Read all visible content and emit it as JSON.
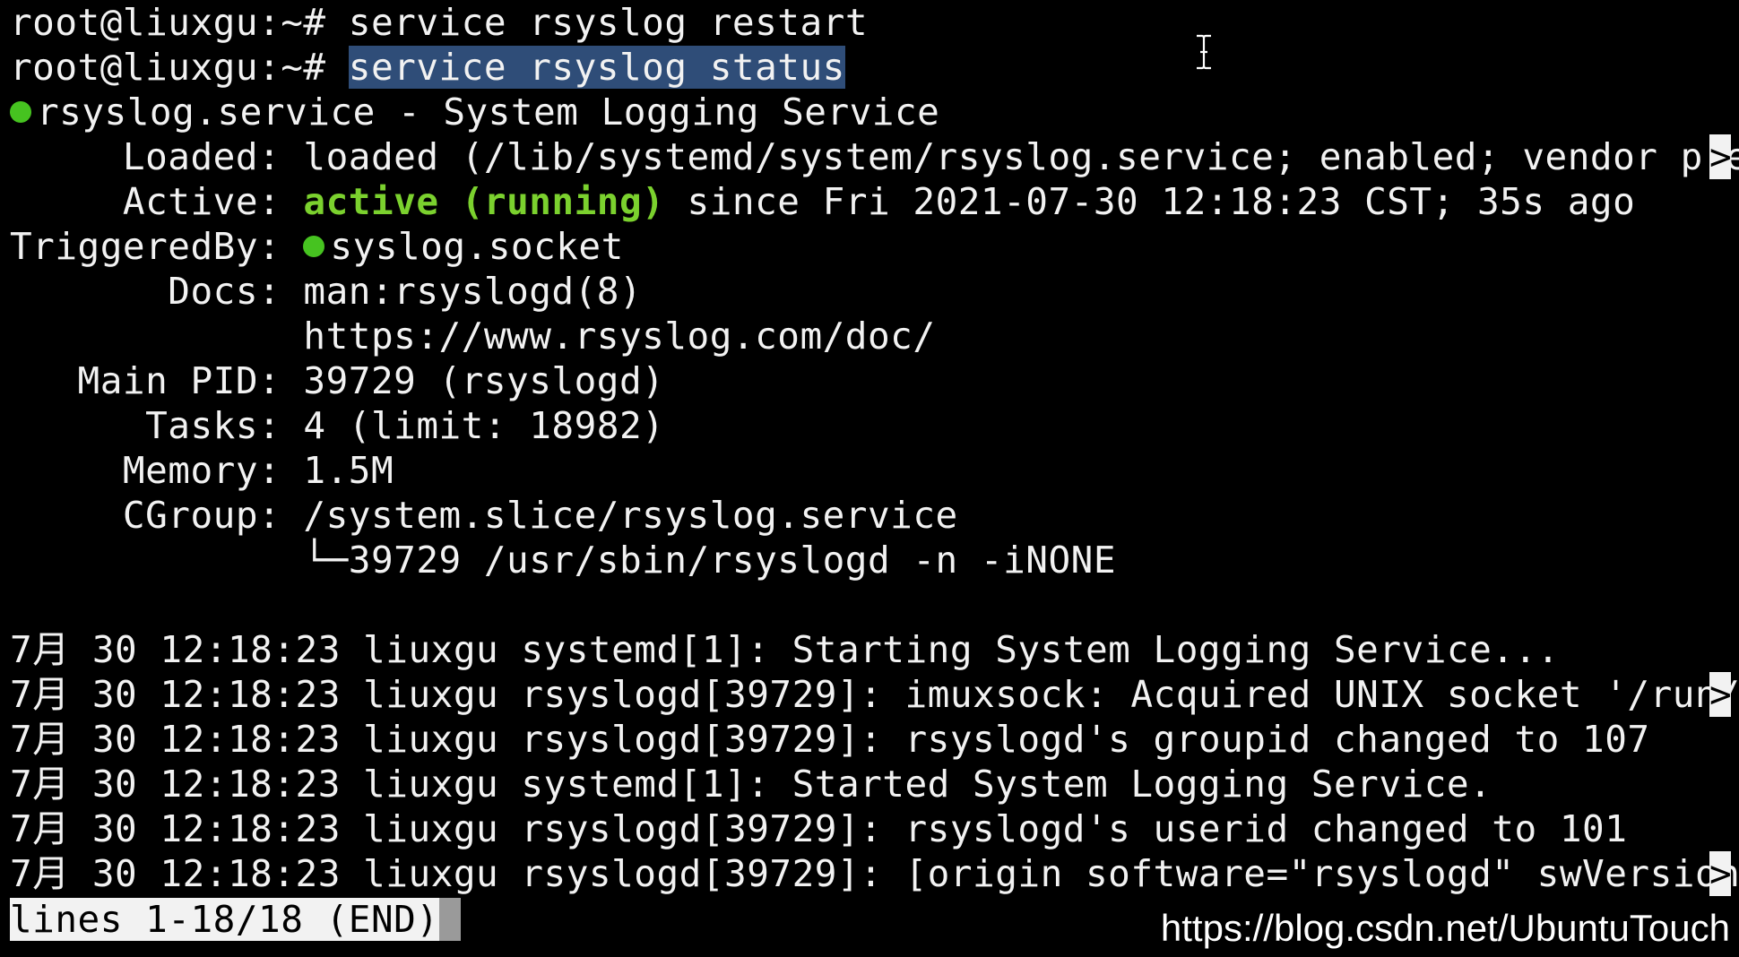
{
  "terminal": {
    "prompt1": "root@liuxgu:~# ",
    "cmd1": "service rsyslog restart",
    "prompt2": "root@liuxgu:~# ",
    "cmd2": "service rsyslog status",
    "service_line": "rsyslog.service - System Logging Service",
    "loaded_label": "     Loaded: ",
    "loaded_value": "loaded (/lib/systemd/system/rsyslog.service; enabled; vendor prese",
    "active_label": "     Active: ",
    "active_status": "active (running)",
    "active_rest": " since Fri 2021-07-30 12:18:23 CST; 35s ago",
    "triggered_label": "TriggeredBy: ",
    "triggered_value": "syslog.socket",
    "docs_label": "       Docs: ",
    "docs_value1": "man:rsyslogd(8)",
    "docs_value2": "             https://www.rsyslog.com/doc/",
    "pid_line": "   Main PID: 39729 (rsyslogd)",
    "tasks_line": "      Tasks: 4 (limit: 18982)",
    "memory_line": "     Memory: 1.5M",
    "cgroup_line": "     CGroup: /system.slice/rsyslog.service",
    "cgroup_child": "             └─39729 /usr/sbin/rsyslogd -n -iNONE",
    "log_lines": [
      "7月 30 12:18:23 liuxgu systemd[1]: Starting System Logging Service...",
      "7月 30 12:18:23 liuxgu rsyslogd[39729]: imuxsock: Acquired UNIX socket '/run/sy",
      "7月 30 12:18:23 liuxgu rsyslogd[39729]: rsyslogd's groupid changed to 107",
      "7月 30 12:18:23 liuxgu systemd[1]: Started System Logging Service.",
      "7月 30 12:18:23 liuxgu rsyslogd[39729]: rsyslogd's userid changed to 101",
      "7月 30 12:18:23 liuxgu rsyslogd[39729]: [origin software=\"rsyslogd\" swVersion=\""
    ],
    "truncation_marker": ">",
    "pager_status": "lines 1-18/18 (END)"
  },
  "watermark": "https://blog.csdn.net/UbuntuTouch",
  "colors": {
    "background": "#000000",
    "text": "#f2f2f2",
    "status_green": "#7bd12e",
    "dot_green": "#46c320",
    "selection": "#2f4d78"
  },
  "icons": {
    "active_dot": "status-dot-icon",
    "cursor": "text-cursor-icon"
  }
}
